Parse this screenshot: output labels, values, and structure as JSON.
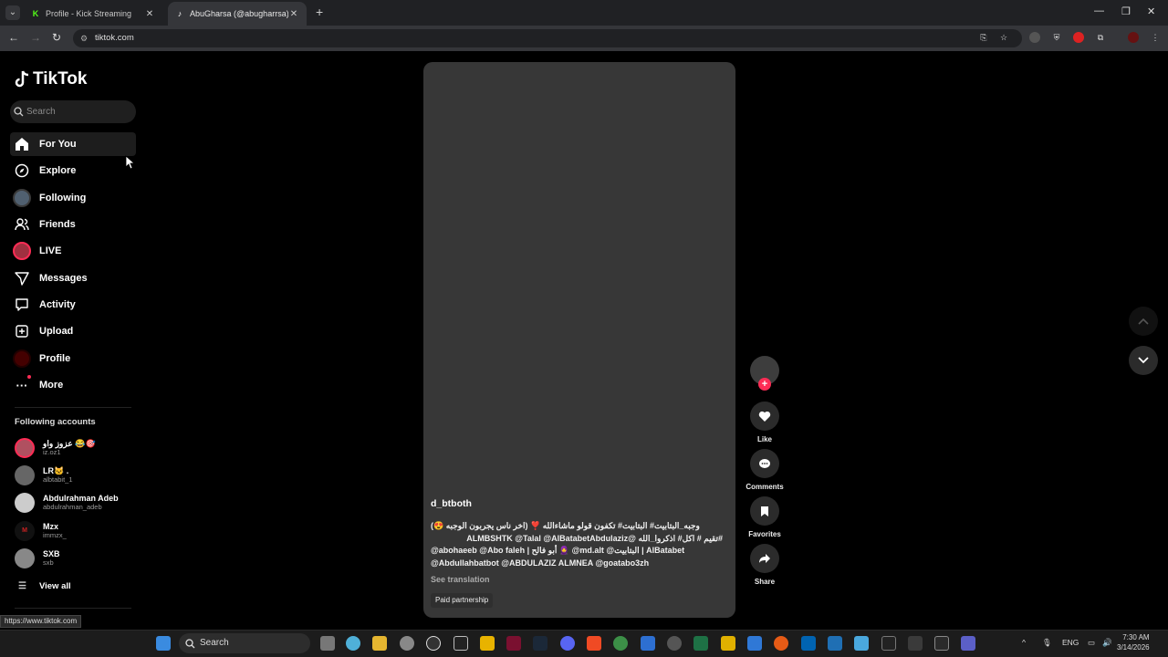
{
  "browser": {
    "tabs": [
      {
        "title": "Profile - Kick Streaming",
        "favicon": "kick-icon",
        "active": false
      },
      {
        "title": "AbuGharsa (@abugharrsa) | Tik",
        "favicon": "tiktok-icon",
        "active": true
      }
    ],
    "url": "tiktok.com",
    "status_url": "https://www.tiktok.com"
  },
  "sidebar": {
    "logo": "TikTok",
    "search_placeholder": "Search",
    "items": [
      {
        "label": "For You",
        "icon": "home-icon"
      },
      {
        "label": "Explore",
        "icon": "compass-icon"
      },
      {
        "label": "Following",
        "icon": "avatar-icon"
      },
      {
        "label": "Friends",
        "icon": "friends-icon"
      },
      {
        "label": "LIVE",
        "icon": "live-avatar-icon"
      },
      {
        "label": "Messages",
        "icon": "send-icon"
      },
      {
        "label": "Activity",
        "icon": "activity-icon"
      },
      {
        "label": "Upload",
        "icon": "plus-square-icon"
      },
      {
        "label": "Profile",
        "icon": "profile-avatar-icon"
      },
      {
        "label": "More",
        "icon": "more-dots-icon"
      }
    ],
    "following_title": "Following accounts",
    "accounts": [
      {
        "name": "عزوز واو 😂🎯",
        "handle": "iz.oz1"
      },
      {
        "name": "LR🐱 .",
        "handle": "albtabit_1"
      },
      {
        "name": "Abdulrahman Adeb",
        "handle": "abdulrahman_adeb"
      },
      {
        "name": "Mzx",
        "handle": "immzx_"
      },
      {
        "name": "SXB",
        "handle": "sxb"
      }
    ],
    "view_all": "View all"
  },
  "video": {
    "author": "d_btboth",
    "description_lines": [
      "وجبه_البتابيت# البتابيت# تكفون قولو ماشاءالله ❣️ (اخر ناس يجربون الوجبه 😍)",
      "#تقيم # اكل# اذكروا_الله @ALMBSHTK @Talal @AlBatabetAbdulaziz",
      "@abohaeeb @Abo faleh | أبو فالح 🧕 @md.alt @البتابيت | AlBatabet",
      "@Abdullahbatbot @ABDULAZIZ ALMNEA @goatabo3zh"
    ],
    "see_translation": "See translation",
    "paid_label": "Paid partnership"
  },
  "actions": {
    "like": "Like",
    "comments": "Comments",
    "favorites": "Favorites",
    "share": "Share"
  },
  "taskbar": {
    "search": "Search",
    "lang": "ENG",
    "time": "7:30 AM",
    "date": "3/14/2026"
  },
  "colors": {
    "accent": "#fe2c55",
    "background": "#000000",
    "video_placeholder": "#373737"
  }
}
